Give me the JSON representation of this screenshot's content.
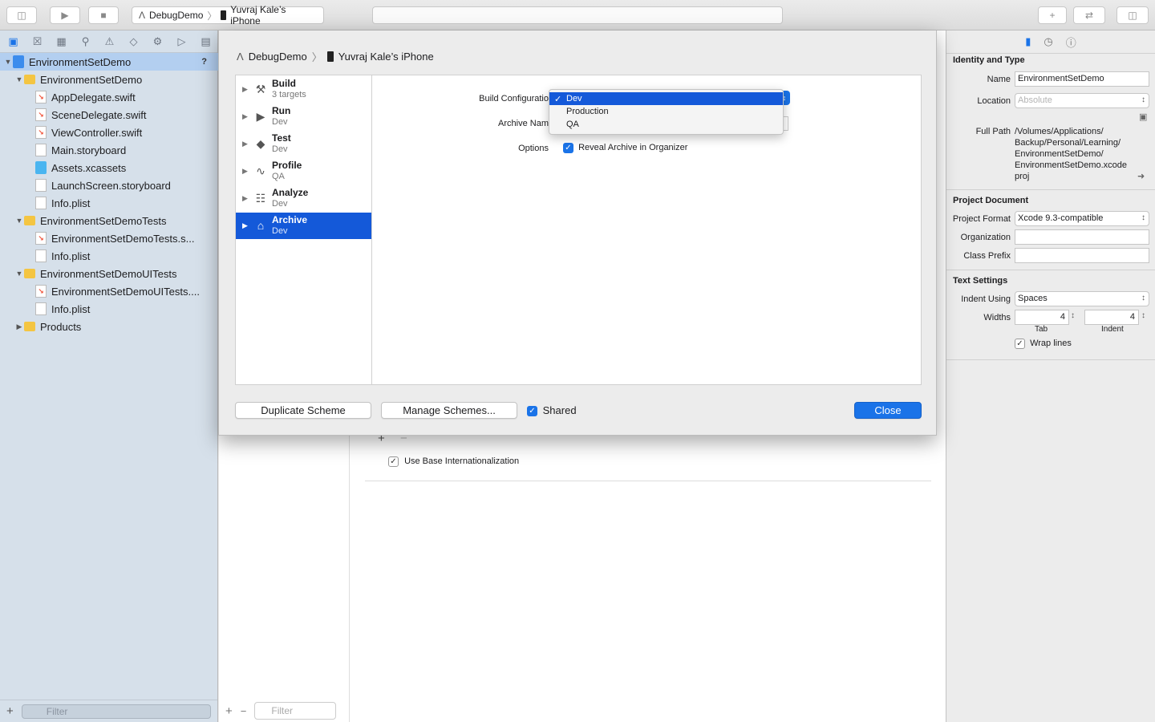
{
  "toolbar": {
    "scheme": "DebugDemo",
    "device": "Yuvraj  Kale’s iPhone"
  },
  "navigator": {
    "items": [
      {
        "label": "EnvironmentSetDemo",
        "level": 0,
        "icon": "project-icon",
        "disclosure": "open",
        "selected": true,
        "badge": "?"
      },
      {
        "label": "EnvironmentSetDemo",
        "level": 1,
        "icon": "folder-icon",
        "disclosure": "open"
      },
      {
        "label": "AppDelegate.swift",
        "level": 2,
        "icon": "swift-file-icon"
      },
      {
        "label": "SceneDelegate.swift",
        "level": 2,
        "icon": "swift-file-icon"
      },
      {
        "label": "ViewController.swift",
        "level": 2,
        "icon": "swift-file-icon"
      },
      {
        "label": "Main.storyboard",
        "level": 2,
        "icon": "storyboard-icon"
      },
      {
        "label": "Assets.xcassets",
        "level": 2,
        "icon": "assets-icon"
      },
      {
        "label": "LaunchScreen.storyboard",
        "level": 2,
        "icon": "storyboard-icon"
      },
      {
        "label": "Info.plist",
        "level": 2,
        "icon": "plist-icon"
      },
      {
        "label": "EnvironmentSetDemoTests",
        "level": 1,
        "icon": "folder-icon",
        "disclosure": "open"
      },
      {
        "label": "EnvironmentSetDemoTests.s...",
        "level": 2,
        "icon": "swift-file-icon"
      },
      {
        "label": "Info.plist",
        "level": 2,
        "icon": "plist-icon"
      },
      {
        "label": "EnvironmentSetDemoUITests",
        "level": 1,
        "icon": "folder-icon",
        "disclosure": "open"
      },
      {
        "label": "EnvironmentSetDemoUITests....",
        "level": 2,
        "icon": "swift-file-icon"
      },
      {
        "label": "Info.plist",
        "level": 2,
        "icon": "plist-icon"
      },
      {
        "label": "Products",
        "level": 1,
        "icon": "folder-icon",
        "disclosure": "closed"
      }
    ],
    "filter_placeholder": "Filter"
  },
  "editor": {
    "filter_placeholder": "Filter",
    "use_base_internationalization": "Use Base Internationalization"
  },
  "inspector": {
    "identity_title": "Identity and Type",
    "name_label": "Name",
    "name_value": "EnvironmentSetDemo",
    "location_label": "Location",
    "location_value": "Absolute",
    "full_path_label": "Full Path",
    "full_path_value": "/Volumes/Applications/ Backup/Personal/Learning/ EnvironmentSetDemo/ EnvironmentSetDemo.xcode proj",
    "project_document_title": "Project Document",
    "project_format_label": "Project Format",
    "project_format_value": "Xcode 9.3-compatible",
    "organization_label": "Organization",
    "organization_value": "",
    "class_prefix_label": "Class Prefix",
    "class_prefix_value": "",
    "text_settings_title": "Text Settings",
    "indent_using_label": "Indent Using",
    "indent_using_value": "Spaces",
    "widths_label": "Widths",
    "tab_width": "4",
    "indent_width": "4",
    "tab_caption": "Tab",
    "indent_caption": "Indent",
    "wrap_lines": "Wrap lines"
  },
  "sheet": {
    "breadcrumb_scheme": "DebugDemo",
    "breadcrumb_device": "Yuvraj  Kale’s iPhone",
    "actions": [
      {
        "name": "Build",
        "sub": "3 targets",
        "icon": "hammer-icon"
      },
      {
        "name": "Run",
        "sub": "Dev",
        "icon": "play-icon"
      },
      {
        "name": "Test",
        "sub": "Dev",
        "icon": "test-icon"
      },
      {
        "name": "Profile",
        "sub": "QA",
        "icon": "profile-icon"
      },
      {
        "name": "Analyze",
        "sub": "Dev",
        "icon": "analyze-icon"
      },
      {
        "name": "Archive",
        "sub": "Dev",
        "icon": "archive-icon",
        "selected": true
      }
    ],
    "build_configuration_label": "Build Configuratio",
    "archive_name_label": "Archive Nam",
    "options_label": "Options",
    "reveal_archive": "Reveal Archive in Organizer",
    "dropdown_options": [
      "Dev",
      "Production",
      "QA"
    ],
    "dropdown_selected": "Dev",
    "duplicate_scheme": "Duplicate Scheme",
    "manage_schemes": "Manage Schemes...",
    "shared": "Shared",
    "close": "Close"
  },
  "colors": {
    "accent": "#1a73e8",
    "selection": "#1459d9",
    "navigator_bg": "#d6e0ea"
  }
}
